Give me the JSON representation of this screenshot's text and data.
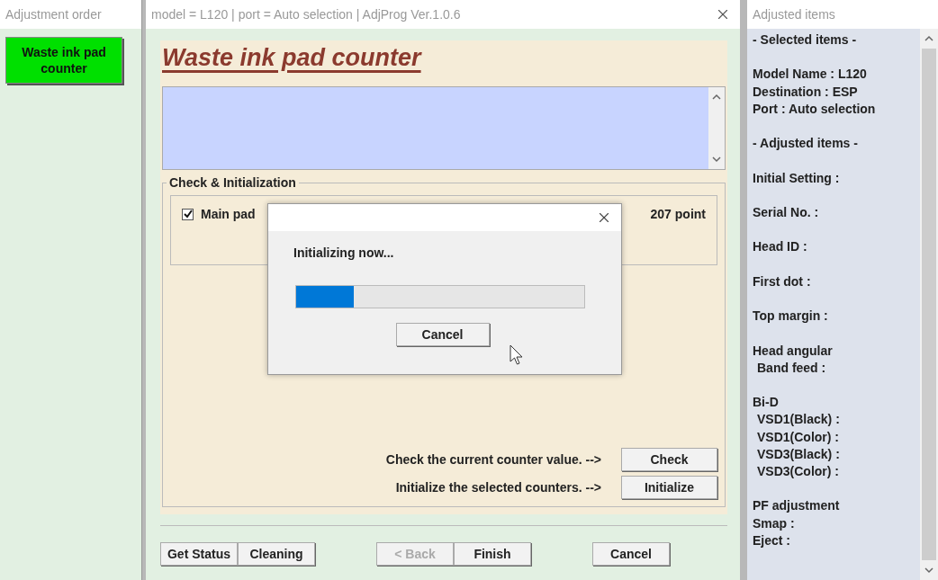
{
  "left_panel": {
    "title": "Adjustment order",
    "items": [
      {
        "label": "Waste ink pad counter",
        "selected": true
      }
    ]
  },
  "main_window": {
    "title": "model = L120 | port = Auto selection | AdjProg Ver.1.0.6",
    "heading": "Waste ink pad counter",
    "group": {
      "title": "Check & Initialization",
      "counters": [
        {
          "label": "Main pad",
          "checked": true,
          "reading": "207 point"
        }
      ]
    },
    "actions": [
      {
        "text": "Check the current counter value. -->",
        "button": "Check"
      },
      {
        "text": "Initialize the selected counters. -->",
        "button": "Initialize"
      }
    ],
    "footer_groups": [
      [
        {
          "label": "Get Status",
          "disabled": false
        },
        {
          "label": "Cleaning",
          "disabled": false
        }
      ],
      [
        {
          "label": "< Back",
          "disabled": true
        },
        {
          "label": "Finish",
          "disabled": false
        }
      ],
      [
        {
          "label": "Cancel",
          "disabled": false
        }
      ]
    ]
  },
  "dialog": {
    "message": "Initializing now...",
    "progress": {
      "level": 0.2
    },
    "button": "Cancel"
  },
  "right_panel": {
    "title": "Adjusted items",
    "sections": [
      [
        {
          "text": "- Selected items -"
        }
      ],
      [
        {
          "text": "Model Name : L120"
        },
        {
          "text": "Destination : ESP"
        },
        {
          "text": "Port : Auto selection"
        }
      ],
      [
        {
          "text": "- Adjusted items -"
        }
      ],
      [
        {
          "text": "Initial Setting :"
        }
      ],
      [
        {
          "text": "Serial No. :"
        }
      ],
      [
        {
          "text": "Head ID :"
        }
      ],
      [
        {
          "text": "First dot :"
        }
      ],
      [
        {
          "text": "Top margin :"
        }
      ],
      [
        {
          "text": "Head angular",
          "children": [
            {
              "text": "Band feed :"
            }
          ]
        }
      ],
      [
        {
          "text": "Bi-D",
          "children": [
            {
              "text": "VSD1(Black) :"
            },
            {
              "text": "VSD1(Color) :"
            },
            {
              "text": "VSD3(Black) :"
            },
            {
              "text": "VSD3(Color) :"
            }
          ]
        }
      ],
      [
        {
          "text": "PF adjustment"
        },
        {
          "text": "Smap :"
        },
        {
          "text": "Eject :"
        }
      ]
    ]
  }
}
